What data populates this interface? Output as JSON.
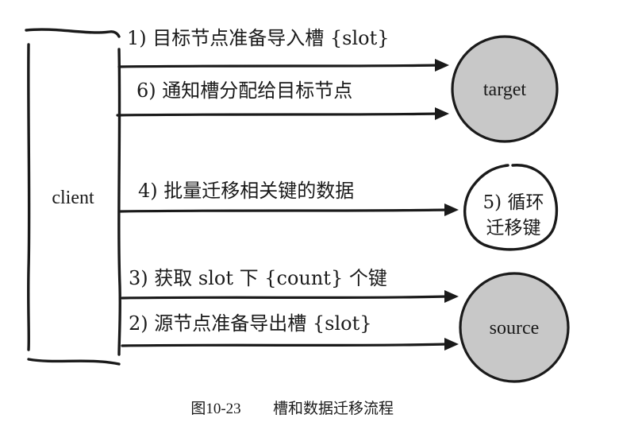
{
  "client": {
    "label": "client"
  },
  "nodes": {
    "target": {
      "label": "target"
    },
    "source": {
      "label": "source"
    }
  },
  "steps": [
    {
      "id": "step1",
      "text": "1) 目标节点准备导入槽 {slot}"
    },
    {
      "id": "step6",
      "text": "6) 通知槽分配给目标节点"
    },
    {
      "id": "step4",
      "text": "4) 批量迁移相关键的数据"
    },
    {
      "id": "step3",
      "text": "3) 获取 slot 下 {count} 个键"
    },
    {
      "id": "step2",
      "text": "2) 源节点准备导出槽 {slot}"
    }
  ],
  "loop_note": {
    "line1": "5) 循环",
    "line2": "迁移键"
  },
  "caption": {
    "figure": "图10-23",
    "title": "槽和数据迁移流程"
  },
  "colors": {
    "ink": "#1a1a1a",
    "node_fill": "#c8c8c8",
    "background": "#ffffff"
  }
}
